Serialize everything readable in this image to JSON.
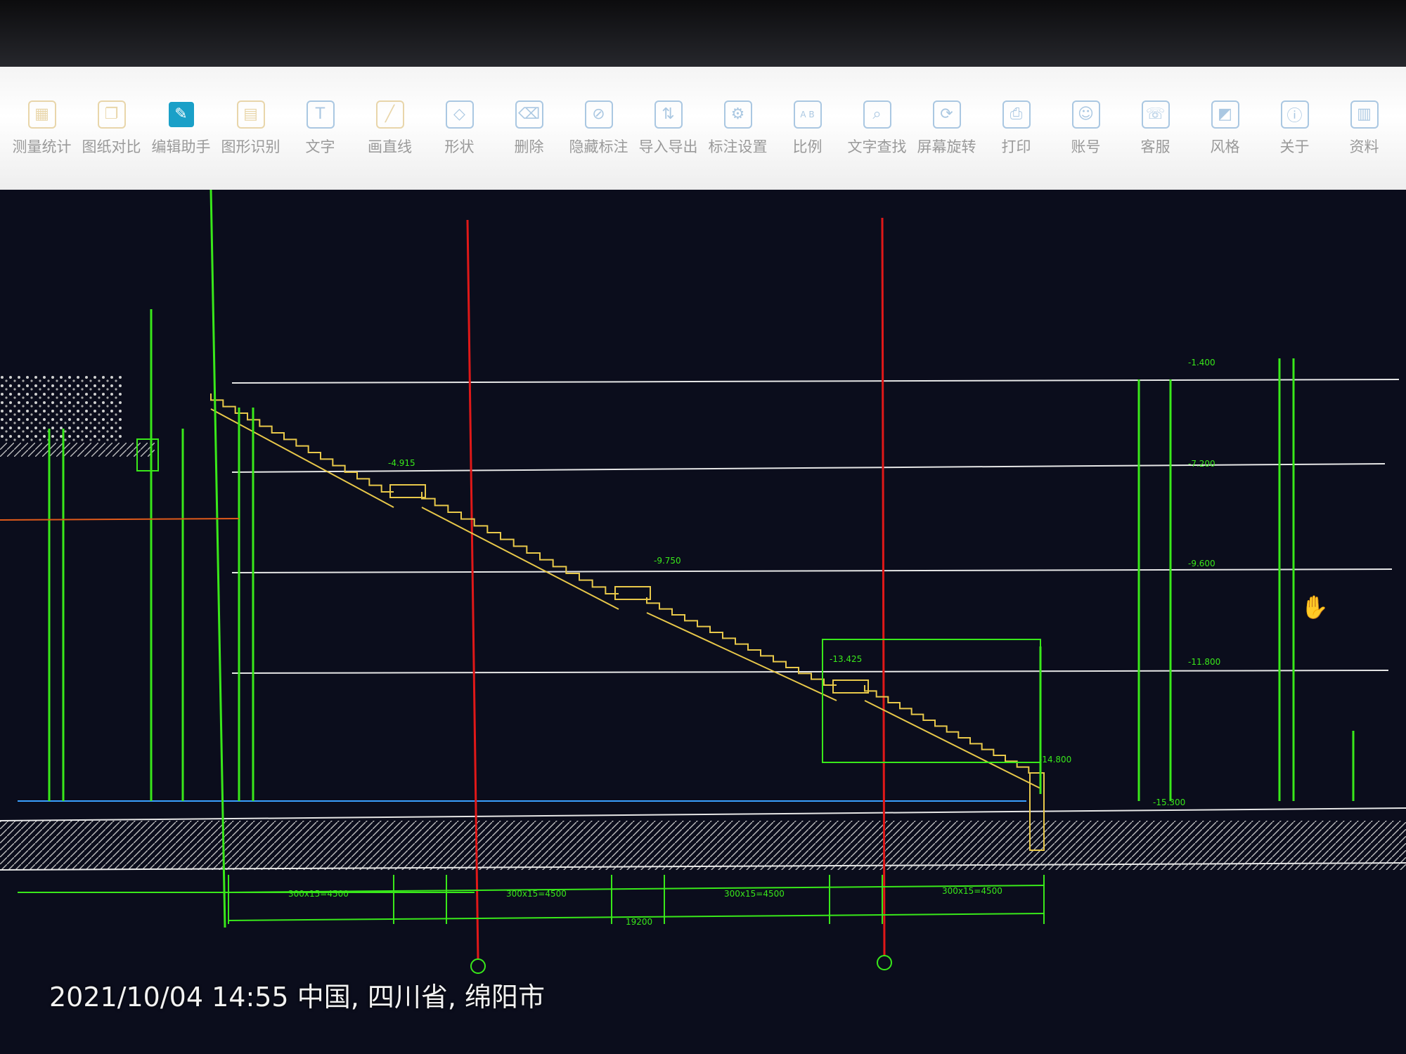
{
  "toolbar": {
    "items": [
      {
        "label": "测量统计",
        "icon": "measure-icon",
        "color": "#e2c98f"
      },
      {
        "label": "图纸对比",
        "icon": "compare-icon",
        "color": "#e2c98f"
      },
      {
        "label": "编辑助手",
        "icon": "edit-assistant-icon",
        "color": "#1aa0c8"
      },
      {
        "label": "图形识别",
        "icon": "shape-recognize-icon",
        "color": "#e2c98f"
      },
      {
        "label": "文字",
        "icon": "text-icon",
        "color": "#8fb6d9"
      },
      {
        "label": "画直线",
        "icon": "line-icon",
        "color": "#e2c98f"
      },
      {
        "label": "形状",
        "icon": "shape-icon",
        "color": "#8fb6d9"
      },
      {
        "label": "删除",
        "icon": "eraser-icon",
        "color": "#8fb6d9"
      },
      {
        "label": "隐藏标注",
        "icon": "hide-annotation-icon",
        "color": "#8fb6d9"
      },
      {
        "label": "导入导出",
        "icon": "import-export-icon",
        "color": "#8fb6d9"
      },
      {
        "label": "标注设置",
        "icon": "annotation-settings-icon",
        "color": "#8fb6d9"
      },
      {
        "label": "比例",
        "icon": "scale-icon",
        "color": "#8fb6d9"
      },
      {
        "label": "文字查找",
        "icon": "text-search-icon",
        "color": "#8fb6d9"
      },
      {
        "label": "屏幕旋转",
        "icon": "rotate-screen-icon",
        "color": "#8fb6d9"
      },
      {
        "label": "打印",
        "icon": "print-icon",
        "color": "#8fb6d9"
      },
      {
        "label": "账号",
        "icon": "account-icon",
        "color": "#8fb6d9"
      },
      {
        "label": "客服",
        "icon": "customer-service-icon",
        "color": "#8fb6d9"
      },
      {
        "label": "风格",
        "icon": "style-icon",
        "color": "#8fb6d9"
      },
      {
        "label": "关于",
        "icon": "about-icon",
        "color": "#8fb6d9"
      },
      {
        "label": "资料",
        "icon": "documents-icon",
        "color": "#8fb6d9"
      }
    ]
  },
  "drawing": {
    "colors": {
      "background": "#0b0d1c",
      "structure": "#39e81a",
      "stair": "#e8c84a",
      "axis": "#e01818",
      "level": "#e6e6e6"
    },
    "level_labels": {
      "top": "-1.400",
      "mid1": "-7.200",
      "mid2": "-9.600",
      "mid3": "-11.800",
      "bottom": "-15.300",
      "landing1": "-4.915",
      "landing2": "-9.750",
      "landing3": "-13.425",
      "right_level": "-14.800"
    },
    "dimensions": {
      "segment1": "300x15=4500",
      "segment2": "300x15=4500",
      "segment3": "300x15=4500",
      "segment4": "300x15=4500",
      "total": "19200"
    }
  },
  "overlay": {
    "timestamp": "2021/10/04 14:55  中国, 四川省, 绵阳市"
  }
}
